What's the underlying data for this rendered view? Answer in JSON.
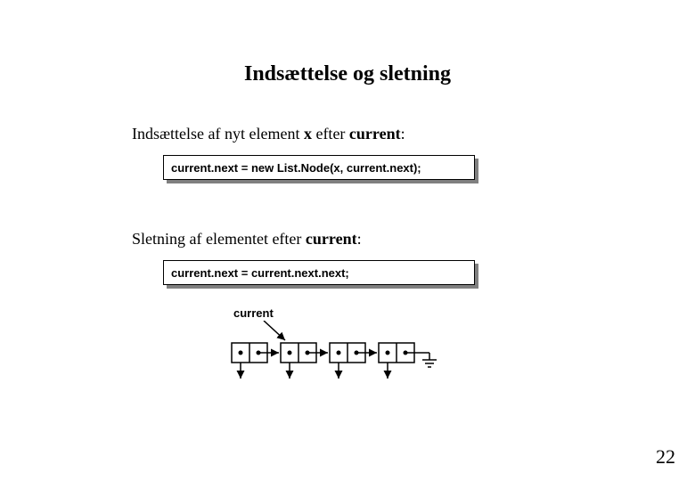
{
  "title": "Indsættelse og sletning",
  "section1": {
    "prefix": "Indsættelse af nyt element ",
    "x": "x",
    "middle": " efter ",
    "target": "current",
    "suffix": ":",
    "code": "current.next = new List.Node(x, current.next);"
  },
  "section2": {
    "prefix": "Sletning af elementet efter ",
    "target": "current",
    "suffix": ":",
    "code": "current.next = current.next.next;"
  },
  "diagram": {
    "pointer_label": "current",
    "node_count": 4
  },
  "page_number": "22"
}
